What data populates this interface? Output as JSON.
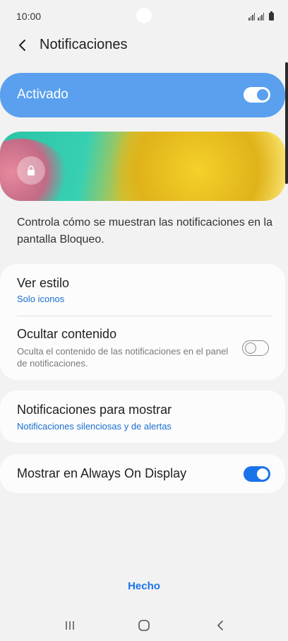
{
  "status_bar": {
    "time": "10:00"
  },
  "header": {
    "title": "Notificaciones"
  },
  "master": {
    "label": "Activado",
    "enabled": true
  },
  "description": "Controla cómo se muestran las notificaciones en la pantalla Bloqueo.",
  "style_card": {
    "ver_estilo": {
      "title": "Ver estilo",
      "value": "Solo iconos"
    },
    "ocultar": {
      "title": "Ocultar contenido",
      "description": "Oculta el contenido de las notificaciones en el panel de notificaciones.",
      "enabled": false
    }
  },
  "show_card": {
    "title": "Notificaciones para mostrar",
    "value": "Notificaciones silenciosas y de alertas"
  },
  "aod_card": {
    "title": "Mostrar en Always On Display",
    "enabled": true
  },
  "footer": {
    "done_label": "Hecho"
  },
  "colors": {
    "accent": "#1a73e8",
    "master_bg": "#5aa0ee",
    "background": "#f2f2f2"
  },
  "icons": [
    "back-icon",
    "lock-icon",
    "recents-icon",
    "home-icon",
    "back-nav-icon",
    "signal-icon",
    "battery-icon"
  ]
}
